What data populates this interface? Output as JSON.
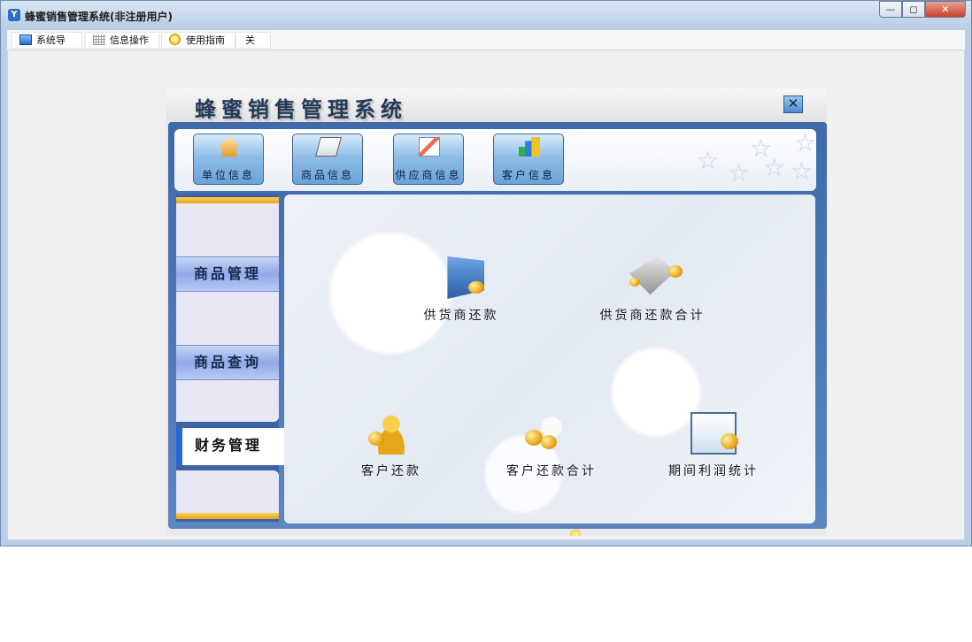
{
  "window": {
    "title": "蜂蜜销售管理系统(非注册用户)",
    "app_icon": "app-logo-icon",
    "controls": {
      "minimize": "—",
      "maximize": "◻",
      "close": "✕"
    }
  },
  "menubar": {
    "items": [
      {
        "label": "系统导航",
        "icon": "navigation-icon"
      },
      {
        "label": "信息操作",
        "icon": "grid-icon"
      },
      {
        "label": "使用指南",
        "icon": "guide-icon"
      },
      {
        "label": "关于"
      }
    ]
  },
  "panel": {
    "title": "蜂蜜销售管理系统",
    "close_symbol": "✕",
    "toolbar": [
      {
        "label": "单位信息",
        "icon": "building-icon"
      },
      {
        "label": "商品信息",
        "icon": "book-icon"
      },
      {
        "label": "供应商信息",
        "icon": "supplier-icon"
      },
      {
        "label": "客户信息",
        "icon": "bar-chart-icon"
      }
    ],
    "sidebar": [
      {
        "label": "商品管理",
        "active": false
      },
      {
        "label": "商品查询",
        "active": false
      },
      {
        "label": "财务管理",
        "active": true
      }
    ],
    "features": [
      {
        "label": "供货商还款",
        "icon": "supplier-payment-icon"
      },
      {
        "label": "供货商还款合计",
        "icon": "supplier-payment-total-icon"
      },
      {
        "label": "客户还款",
        "icon": "customer-payment-icon"
      },
      {
        "label": "客户还款合计",
        "icon": "customer-payment-total-icon"
      },
      {
        "label": "期间利润统计",
        "icon": "profit-statistics-icon"
      }
    ]
  },
  "colors": {
    "title_bar": "#b8cce4",
    "frame_blue": "#3f69a9",
    "sidebar_active_accent": "#2868d8",
    "gold": "#e6a21a"
  }
}
